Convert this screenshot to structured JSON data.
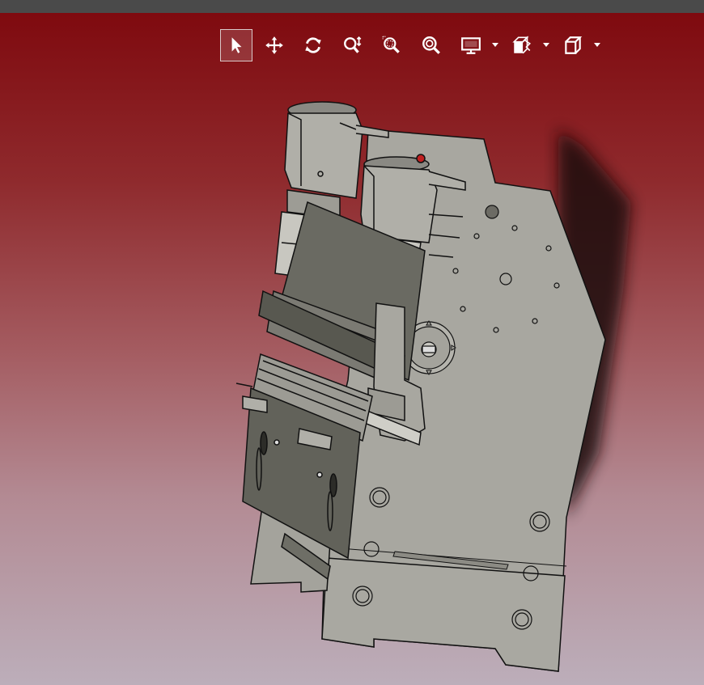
{
  "window": {
    "title": ""
  },
  "toolbar": {
    "tools": [
      {
        "name": "select-tool",
        "icon": "cursor-arrow-icon",
        "active": true
      },
      {
        "name": "pan-tool",
        "icon": "move-arrows-icon",
        "active": false
      },
      {
        "name": "rotate-tool",
        "icon": "rotate-icon",
        "active": false
      },
      {
        "name": "zoom-in-out-tool",
        "icon": "zoom-updown-icon",
        "active": false
      },
      {
        "name": "zoom-window-tool",
        "icon": "zoom-window-icon",
        "active": false
      },
      {
        "name": "zoom-fit-tool",
        "icon": "zoom-fit-icon",
        "active": false
      },
      {
        "name": "display-mode-tool",
        "icon": "monitor-icon",
        "active": false,
        "dropdown": true
      },
      {
        "name": "sectioning-tool",
        "icon": "section-box-icon",
        "active": false,
        "dropdown": true
      },
      {
        "name": "view-orientation-tool",
        "icon": "cube-icon",
        "active": false,
        "dropdown": true
      }
    ],
    "icon_color": "#ffffff"
  },
  "viewport": {
    "background_top": "#7f0a0f",
    "background_bottom": "#bcaeba",
    "model": "press-brake-assembly-3d"
  },
  "colors": {
    "part_fill": "#a8a7a0",
    "part_dark": "#5d5d55",
    "edge": "#111111",
    "shadow": "#1a0a0c"
  }
}
